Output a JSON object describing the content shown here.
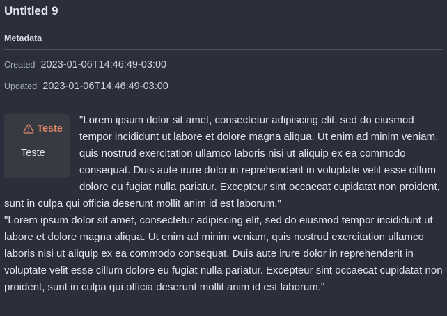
{
  "note": {
    "title": "Untitled 9"
  },
  "metadata": {
    "header": "Metadata",
    "created_label": "Created",
    "created_value": "2023-01-06T14:46:49-03:00",
    "updated_label": "Updated",
    "updated_value": "2023-01-06T14:46:49-03:00"
  },
  "callout": {
    "type": "warning",
    "icon": "warning-triangle-icon",
    "title": "Teste",
    "body": "Teste",
    "accent_color": "#e2866a"
  },
  "content": {
    "paragraphs": [
      "\"Lorem ipsum dolor sit amet, consectetur adipiscing elit, sed do eiusmod tempor incididunt ut labore et dolore magna aliqua. Ut enim ad minim veniam, quis nostrud exercitation ullamco laboris nisi ut aliquip ex ea commodo consequat. Duis aute irure dolor in reprehenderit in voluptate velit esse cillum dolore eu fugiat nulla pariatur. Excepteur sint occaecat cupidatat non proident, sunt in culpa qui officia deserunt mollit anim id est laborum.\"",
      "\"Lorem ipsum dolor sit amet, consectetur adipiscing elit, sed do eiusmod tempor incididunt ut labore et dolore magna aliqua. Ut enim ad minim veniam, quis nostrud exercitation ullamco laboris nisi ut aliquip ex ea commodo consequat. Duis aute irure dolor in reprehenderit in voluptate velit esse cillum dolore eu fugiat nulla pariatur. Excepteur sint occaecat cupidatat non proident, sunt in culpa qui officia deserunt mollit anim id est laborum.\""
    ]
  },
  "colors": {
    "background": "#2a2f3b",
    "text": "#e2e5eb",
    "muted": "#a7adb9",
    "callout_background": "#373a41"
  }
}
